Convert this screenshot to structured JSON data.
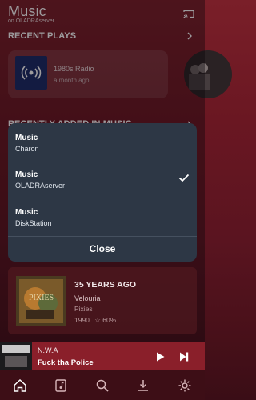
{
  "header": {
    "title": "Music",
    "subtitle": "on OLADRAserver"
  },
  "recent": {
    "section_title": "RECENT PLAYS",
    "items": [
      {
        "title": "1980s Radio",
        "subtitle": "a month ago"
      }
    ]
  },
  "recently_added": {
    "section_title": "RECENTLY ADDED IN MUSIC"
  },
  "server_picker": {
    "options": [
      {
        "name": "Music",
        "server": "Charon",
        "selected": false
      },
      {
        "name": "Music",
        "server": "OLADRAserver",
        "selected": true
      },
      {
        "name": "Music",
        "server": "DiskStation",
        "selected": false
      }
    ],
    "close_label": "Close"
  },
  "history": {
    "title": "35 YEARS AGO",
    "song": "Velouria",
    "artist": "Pixies",
    "year": "1990",
    "rating": "60%"
  },
  "player": {
    "artist": "N.W.A",
    "song": "Fuck tha Police"
  },
  "nav": {
    "active": "home"
  },
  "colors": {
    "background": "#6a1722",
    "sheet": "#2d3745",
    "player": "#8a1f2a",
    "nav": "#3d0e16"
  }
}
